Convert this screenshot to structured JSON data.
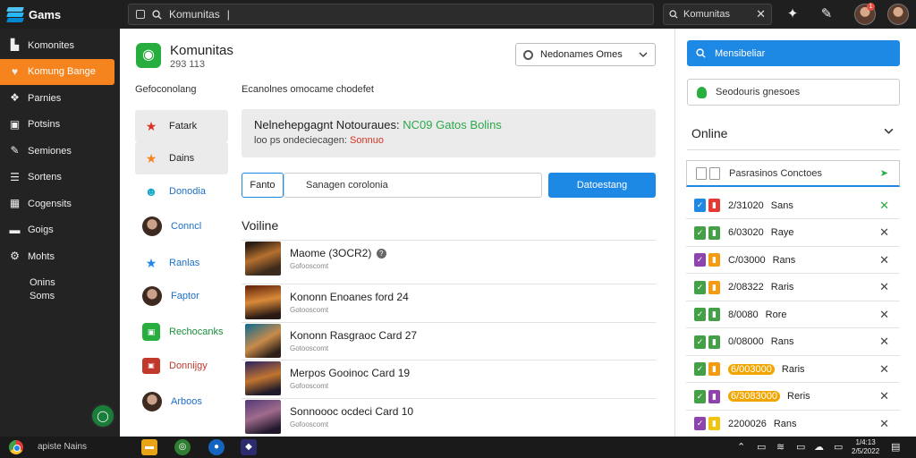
{
  "topbar": {
    "brand": "Gams",
    "address": "Komunitas",
    "search": "Komunitas",
    "notification_count": "1"
  },
  "sidebar": {
    "items": [
      {
        "label": "Komonites",
        "icon": "home-icon"
      },
      {
        "label": "Komung Bange",
        "icon": "heart-icon",
        "active": true
      },
      {
        "label": "Parnies",
        "icon": "puzzle-icon"
      },
      {
        "label": "Potsins",
        "icon": "briefcase-icon"
      },
      {
        "label": "Semiones",
        "icon": "edit-icon"
      },
      {
        "label": "Sortens",
        "icon": "list-icon"
      },
      {
        "label": "Cogensits",
        "icon": "grid-icon"
      },
      {
        "label": "Goigs",
        "icon": "folder-icon"
      },
      {
        "label": "Mohts",
        "icon": "settings-icon"
      }
    ],
    "footer_lines": [
      "Onins",
      "Soms"
    ]
  },
  "main": {
    "title": "Komunitas",
    "subtitle": "293 113",
    "select_label": "Nedonames Omes",
    "left_heading": "Gefoconolang",
    "right_heading": "Ecanolnes omocame chodefet",
    "categories": [
      {
        "label": "Fatark",
        "icon": "star-icon"
      },
      {
        "label": "Dains",
        "icon": "star-icon"
      },
      {
        "label": "Donodia",
        "icon": "avatar-icon"
      },
      {
        "label": "Conncl",
        "icon": "avatar-icon"
      },
      {
        "label": "Ranlas",
        "icon": "star-icon"
      },
      {
        "label": "Faptor",
        "icon": "avatar-icon"
      },
      {
        "label": "Rechocanks",
        "icon": "badge-icon"
      },
      {
        "label": "Donnijgy",
        "icon": "badge-icon"
      },
      {
        "label": "Arboos",
        "icon": "avatar-icon"
      }
    ],
    "info_line1_a": "Nelnehepgagnt Notouraues:",
    "info_line1_b": "NC09 Gatos Bolins",
    "info_line2_a": "loo ps ondeciecagen:",
    "info_line2_b": "Sonnuo",
    "tab_label": "Fanto",
    "input_value": "Sanagen corolonia",
    "button_label": "Datoestang",
    "list_heading": "Voiline",
    "games": [
      {
        "name": "Maome (3OCR2)",
        "sub": "Gofooscomt",
        "has_q": true
      },
      {
        "name": "Kononn Enoanes ford 24",
        "sub": "Gotooscomt",
        "has_q": false
      },
      {
        "name": "Kononn Rasgraoc Card 27",
        "sub": "Gotooscomt",
        "has_q": false
      },
      {
        "name": "Merpos Gooinoc Card 19",
        "sub": "Gofooscomt",
        "has_q": false
      },
      {
        "name": "Sonnoooc ocdeci Card 10",
        "sub": "Gofooscomt",
        "has_q": false
      }
    ]
  },
  "right": {
    "button_label": "Mensibeliar",
    "search_label": "Seodouris gnesoes",
    "online_label": "Online",
    "header_label": "Pasrasinos Conctoes",
    "rows": [
      {
        "date": "2/31020",
        "name": "Sans",
        "c1": "#1e88e5",
        "c2": "#e53935",
        "highlight": false
      },
      {
        "date": "6/03020",
        "name": "Raye",
        "c1": "#43a047",
        "c2": "#43a047",
        "highlight": false
      },
      {
        "date": "C/03000",
        "name": "Rans",
        "c1": "#8e44ad",
        "c2": "#f39c12",
        "highlight": false
      },
      {
        "date": "2/08322",
        "name": "Raris",
        "c1": "#43a047",
        "c2": "#f39c12",
        "highlight": false
      },
      {
        "date": "8/0080",
        "name": "Rore",
        "c1": "#43a047",
        "c2": "#43a047",
        "highlight": false
      },
      {
        "date": "0/08000",
        "name": "Rans",
        "c1": "#43a047",
        "c2": "#43a047",
        "highlight": false
      },
      {
        "date": "6/003000",
        "name": "Raris",
        "c1": "#43a047",
        "c2": "#f39c12",
        "highlight": true
      },
      {
        "date": "6/3083000",
        "name": "Reris",
        "c1": "#43a047",
        "c2": "#8e44ad",
        "highlight": true
      },
      {
        "date": "2200026",
        "name": "Rans",
        "c1": "#8e44ad",
        "c2": "#f1c40f",
        "highlight": false
      }
    ]
  },
  "taskbar": {
    "label": "apiste Nains",
    "clock_time": "1/4:13",
    "clock_date": "2/5/2022"
  },
  "colors": {
    "accent_orange": "#f5841f",
    "accent_blue": "#1e88e5",
    "accent_green": "#27ae3f"
  }
}
